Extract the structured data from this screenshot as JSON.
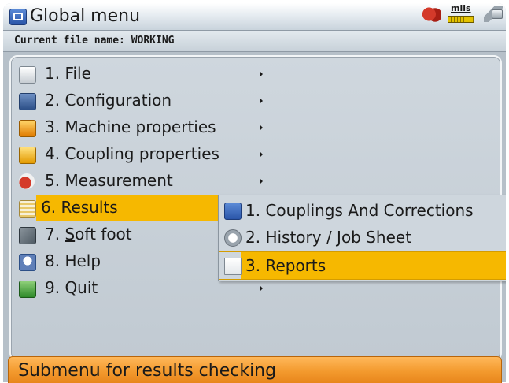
{
  "titlebar": {
    "title": "Global menu",
    "app_icon": "app-icon",
    "unit_label": "mils",
    "status_icons": [
      "machine-icon",
      "units-ruler-icon",
      "plug-icon"
    ]
  },
  "filebar": {
    "text": "Current file name: WORKING"
  },
  "menu": {
    "items": [
      {
        "label": "1. File",
        "icon": "file-icon",
        "has_submenu": true
      },
      {
        "label": "2. Configuration",
        "icon": "configuration-icon",
        "has_submenu": true
      },
      {
        "label": "3. Machine properties",
        "icon": "machine-properties-icon",
        "has_submenu": true
      },
      {
        "label": "4. Coupling properties",
        "icon": "coupling-properties-icon",
        "has_submenu": true
      },
      {
        "label": "5. Measurement",
        "icon": "measurement-icon",
        "has_submenu": true
      },
      {
        "label": "6. Results",
        "icon": "results-icon",
        "has_submenu": true,
        "selected": true
      },
      {
        "label_prefix": "7. ",
        "label_underlined": "S",
        "label_suffix": "oft foot",
        "icon": "soft-foot-icon",
        "has_submenu": false
      },
      {
        "label": "8. Help",
        "icon": "help-icon",
        "has_submenu": false
      },
      {
        "label": "9. Quit",
        "icon": "quit-icon",
        "has_submenu": true
      }
    ]
  },
  "submenu": {
    "items": [
      {
        "label": "1. Couplings And Corrections",
        "icon": "couplings-icon"
      },
      {
        "label": "2. History / Job Sheet",
        "icon": "history-icon"
      },
      {
        "label": "3. Reports",
        "icon": "reports-icon",
        "selected": true
      }
    ]
  },
  "statusbar": {
    "text": "Submenu for results checking"
  },
  "colors": {
    "highlight": "#f6b800",
    "background": "#b6c0c9",
    "statusbar": "#f39a2e"
  }
}
